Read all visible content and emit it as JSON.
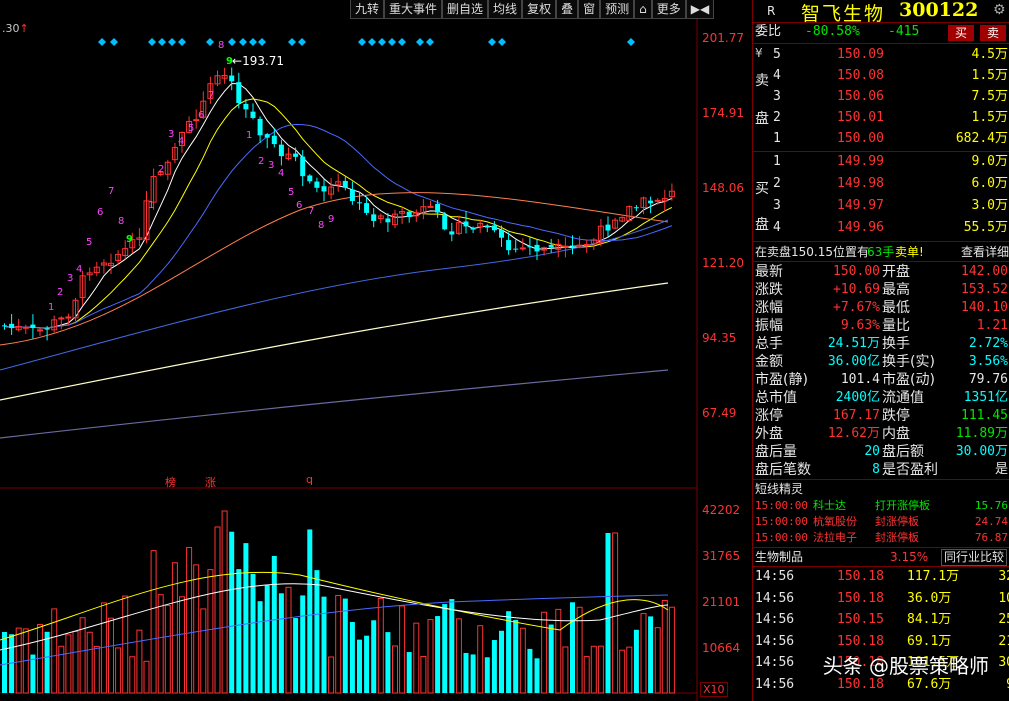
{
  "toolbar": [
    "九转",
    "重大事件",
    "删自选",
    "均线",
    "复权",
    "叠",
    "窗",
    "预测",
    "",
    "更多"
  ],
  "chart": {
    "top_left": ".30",
    "price_axis": [
      "201.77",
      "174.91",
      "148.06",
      "121.20",
      "94.35",
      "67.49"
    ],
    "vol_axis": [
      "42202",
      "31765",
      "21101",
      "10664"
    ],
    "vol_unit": "X10",
    "high_label": "193.71",
    "markers": [
      "榜",
      "涨",
      "q"
    ]
  },
  "header": {
    "r": "R",
    "name": "智飞生物",
    "code": "300122"
  },
  "weibi": {
    "label": "委比",
    "pct": "-80.58%",
    "diff": "-415",
    "buy": "买",
    "sell": "卖"
  },
  "sell_side": {
    "label_top": "卖",
    "label_bottom": "盘",
    "symbol": "¥"
  },
  "buy_side": {
    "label_top": "买",
    "label_bottom": "盘"
  },
  "asks": [
    {
      "lvl": "5",
      "price": "150.09",
      "vol": "4.5万"
    },
    {
      "lvl": "4",
      "price": "150.08",
      "vol": "1.5万"
    },
    {
      "lvl": "3",
      "price": "150.06",
      "vol": "7.5万"
    },
    {
      "lvl": "2",
      "price": "150.01",
      "vol": "1.5万"
    },
    {
      "lvl": "1",
      "price": "150.00",
      "vol": "682.4万"
    }
  ],
  "bids": [
    {
      "lvl": "1",
      "price": "149.99",
      "vol": "9.0万"
    },
    {
      "lvl": "2",
      "price": "149.98",
      "vol": "6.0万"
    },
    {
      "lvl": "3",
      "price": "149.97",
      "vol": "3.0万"
    },
    {
      "lvl": "4",
      "price": "149.96",
      "vol": "55.5万"
    }
  ],
  "notice": {
    "pre": "在卖盘",
    "price": "150.15",
    "mid": "位置有",
    "qty": "63手",
    "act": "卖单!",
    "detail": "查看详细"
  },
  "quote": [
    {
      "l1": "最新",
      "v1": "150.00",
      "c1": "red",
      "l2": "开盘",
      "v2": "142.00",
      "c2": "red"
    },
    {
      "l1": "涨跌",
      "v1": "+10.69",
      "c1": "red",
      "l2": "最高",
      "v2": "153.52",
      "c2": "red"
    },
    {
      "l1": "涨幅",
      "v1": "+7.67%",
      "c1": "red",
      "l2": "最低",
      "v2": "140.10",
      "c2": "red"
    },
    {
      "l1": "振幅",
      "v1": "9.63%",
      "c1": "red",
      "l2": "量比",
      "v2": "1.21",
      "c2": "red"
    },
    {
      "l1": "总手",
      "v1": "24.51万",
      "c1": "cyan",
      "l2": "换手",
      "v2": "2.72%",
      "c2": "cyan"
    },
    {
      "l1": "金额",
      "v1": "36.00亿",
      "c1": "cyan",
      "l2": "换手(实)",
      "v2": "3.56%",
      "c2": "cyan"
    },
    {
      "l1": "市盈(静)",
      "v1": "101.4",
      "c1": "white",
      "l2": "市盈(动)",
      "v2": "79.76",
      "c2": "white"
    },
    {
      "l1": "总市值",
      "v1": "2400亿",
      "c1": "cyan",
      "l2": "流通值",
      "v2": "1351亿",
      "c2": "cyan"
    },
    {
      "l1": "涨停",
      "v1": "167.17",
      "c1": "red",
      "l2": "跌停",
      "v2": "111.45",
      "c2": "green"
    },
    {
      "l1": "外盘",
      "v1": "12.62万",
      "c1": "red",
      "l2": "内盘",
      "v2": "11.89万",
      "c2": "green"
    },
    {
      "l1": "盘后量",
      "v1": "20",
      "c1": "cyan",
      "l2": "盘后额",
      "v2": "30.00万",
      "c2": "cyan"
    },
    {
      "l1": "盘后笔数",
      "v1": "8",
      "c1": "cyan",
      "l2": "是否盈利",
      "v2": "是",
      "c2": "white"
    }
  ],
  "sprite": {
    "title": "短线精灵",
    "items": [
      {
        "t": "15:00:00",
        "n": "科士达",
        "e": "打开涨停板",
        "v": "15.76",
        "c": "green"
      },
      {
        "t": "15:00:00",
        "n": "杭氧股份",
        "e": "封涨停板",
        "v": "24.74",
        "c": "red"
      },
      {
        "t": "15:00:00",
        "n": "法拉电子",
        "e": "封涨停板",
        "v": "76.87",
        "c": "red"
      }
    ]
  },
  "sector": {
    "name": "生物制品",
    "pct": "3.15%",
    "cmp": "同行业比较"
  },
  "ticks": [
    {
      "t": "14:56",
      "p": "150.18",
      "v": "117.1万",
      "n": "32"
    },
    {
      "t": "14:56",
      "p": "150.18",
      "v": "36.0万",
      "n": "10"
    },
    {
      "t": "14:56",
      "p": "150.15",
      "v": "84.1万",
      "n": "25"
    },
    {
      "t": "14:56",
      "p": "150.18",
      "v": "69.1万",
      "n": "21"
    },
    {
      "t": "14:56",
      "p": "150.18",
      "v": "101.5万",
      "n": "30"
    },
    {
      "t": "14:56",
      "p": "150.18",
      "v": "67.6万",
      "n": "9"
    }
  ],
  "watermark": "头条 @股票策略师"
}
